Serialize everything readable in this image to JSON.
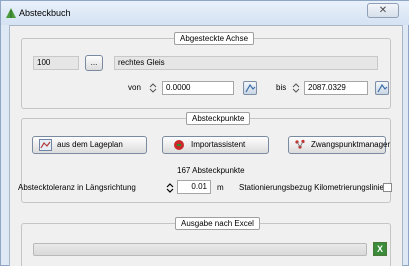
{
  "window": {
    "title": "Absteckbuch",
    "close_glyph": "✕"
  },
  "axis_group": {
    "legend": "Abgesteckte Achse",
    "axis_number": "100",
    "browse_label": "...",
    "axis_name": "rechtes Gleis",
    "from_label": "von",
    "from_value": "0.0000",
    "to_label": "bis",
    "to_value": "2087.0329"
  },
  "points_group": {
    "legend": "Absteckpunkte",
    "from_plan_label": "aus dem Lageplan",
    "import_label": "Importassistent",
    "constraint_label": "Zwangspunktmanager",
    "count_text": "167 Absteckpunkte",
    "tolerance_label": "Absteckt​oleranz in Längsrichtung",
    "tolerance_value": "0.01",
    "tolerance_unit": "m",
    "station_ref_label": "Stationierungsbezug Kilometrierungslinie",
    "station_ref_checked": false
  },
  "excel_group": {
    "legend": "Ausgabe nach Excel",
    "progress": 0
  },
  "icons": {
    "app": "green-tree-icon",
    "plan": "map-icon",
    "import": "red-ball-icon",
    "constraint": "points-icon",
    "excel": "excel-icon"
  },
  "colors": {
    "window_frame": "#dfe9f5",
    "client_bg": "#f0f0f0",
    "excel_green": "#3a8b3a"
  }
}
